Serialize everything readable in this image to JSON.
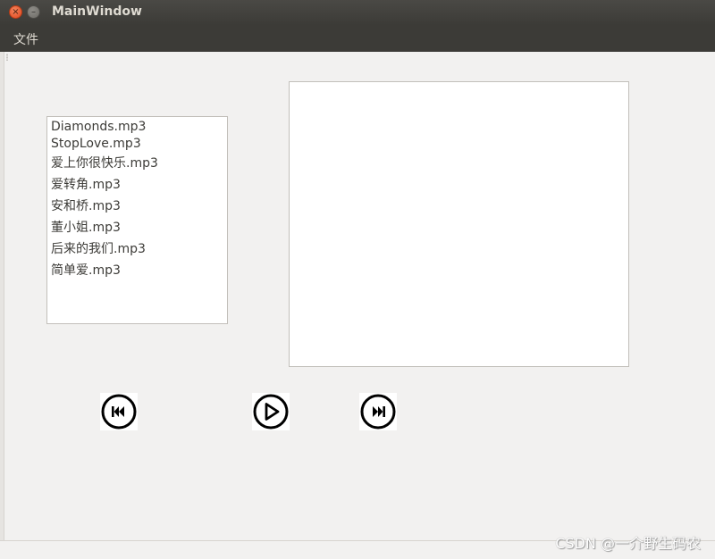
{
  "window": {
    "title": "MainWindow",
    "close_glyph": "×",
    "minimize_glyph": "–"
  },
  "menubar": {
    "items": [
      {
        "label": "文件"
      }
    ]
  },
  "playlist": {
    "items": [
      {
        "label": "Diamonds.mp3"
      },
      {
        "label": "StopLove.mp3"
      },
      {
        "label": "爱上你很快乐.mp3"
      },
      {
        "label": "爱转角.mp3"
      },
      {
        "label": "安和桥.mp3"
      },
      {
        "label": "董小姐.mp3"
      },
      {
        "label": "后来的我们.mp3"
      },
      {
        "label": "简单爱.mp3"
      }
    ]
  },
  "controls": {
    "previous_icon": "skip-previous-icon",
    "play_icon": "play-icon",
    "next_icon": "skip-next-icon"
  },
  "watermark": {
    "text": "CSDN @一介野生码农"
  },
  "colors": {
    "titlebar": "#3c3b37",
    "window_bg": "#f2f1f0",
    "close_button": "#e0461d",
    "icon": "#000000"
  }
}
